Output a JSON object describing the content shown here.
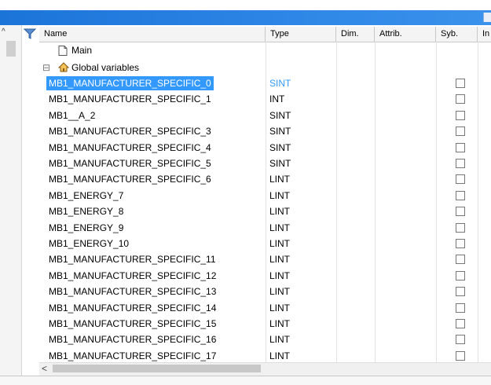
{
  "header": {
    "name": "Name",
    "type": "Type",
    "dim": "Dim.",
    "attrib": "Attrib.",
    "syb": "Syb.",
    "in": "In"
  },
  "tree": {
    "main_label": "Main",
    "global_label": "Global variables",
    "expander": "⊟"
  },
  "rows": [
    {
      "name": "MB1_MANUFACTURER_SPECIFIC_0",
      "type": "SINT",
      "selected": true
    },
    {
      "name": "MB1_MANUFACTURER_SPECIFIC_1",
      "type": "INT"
    },
    {
      "name": "MB1__A_2",
      "type": "SINT"
    },
    {
      "name": "MB1_MANUFACTURER_SPECIFIC_3",
      "type": "SINT"
    },
    {
      "name": "MB1_MANUFACTURER_SPECIFIC_4",
      "type": "SINT"
    },
    {
      "name": "MB1_MANUFACTURER_SPECIFIC_5",
      "type": "SINT"
    },
    {
      "name": "MB1_MANUFACTURER_SPECIFIC_6",
      "type": "LINT"
    },
    {
      "name": "MB1_ENERGY_7",
      "type": "LINT"
    },
    {
      "name": "MB1_ENERGY_8",
      "type": "LINT"
    },
    {
      "name": "MB1_ENERGY_9",
      "type": "LINT"
    },
    {
      "name": "MB1_ENERGY_10",
      "type": "LINT"
    },
    {
      "name": "MB1_MANUFACTURER_SPECIFIC_11",
      "type": "LINT"
    },
    {
      "name": "MB1_MANUFACTURER_SPECIFIC_12",
      "type": "LINT"
    },
    {
      "name": "MB1_MANUFACTURER_SPECIFIC_13",
      "type": "LINT"
    },
    {
      "name": "MB1_MANUFACTURER_SPECIFIC_14",
      "type": "LINT"
    },
    {
      "name": "MB1_MANUFACTURER_SPECIFIC_15",
      "type": "LINT"
    },
    {
      "name": "MB1_MANUFACTURER_SPECIFIC_16",
      "type": "LINT"
    },
    {
      "name": "MB1_MANUFACTURER_SPECIFIC_17",
      "type": "LINT"
    }
  ],
  "icons": {
    "collapse": "^",
    "filter": "filter-icon",
    "document": "document-icon",
    "home": "home-icon",
    "scroll_left": "<"
  },
  "colors": {
    "titlebar": "#2e86e6",
    "selection": "#3399ff"
  }
}
